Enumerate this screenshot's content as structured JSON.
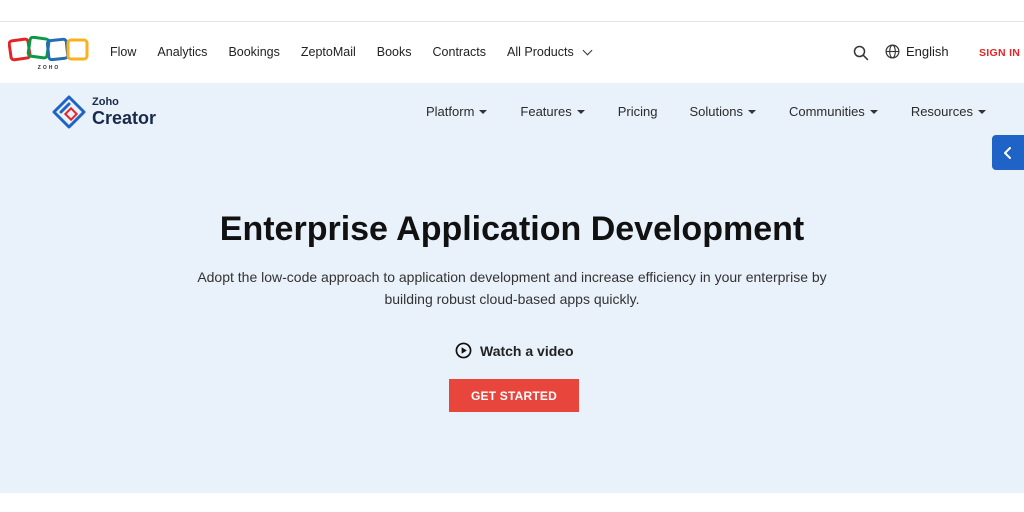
{
  "global_nav": {
    "logo_text": "ZOHO",
    "items": [
      {
        "label": "Flow"
      },
      {
        "label": "Analytics"
      },
      {
        "label": "Bookings"
      },
      {
        "label": "ZeptoMail"
      },
      {
        "label": "Books"
      },
      {
        "label": "Contracts"
      },
      {
        "label": "All Products"
      }
    ],
    "language": "English",
    "sign_in": "SIGN IN"
  },
  "product_header": {
    "brand_top": "Zoho",
    "brand_name": "Creator",
    "menu": [
      {
        "label": "Platform",
        "has_dropdown": true
      },
      {
        "label": "Features",
        "has_dropdown": true
      },
      {
        "label": "Pricing",
        "has_dropdown": false
      },
      {
        "label": "Solutions",
        "has_dropdown": true
      },
      {
        "label": "Communities",
        "has_dropdown": true
      },
      {
        "label": "Resources",
        "has_dropdown": true
      }
    ]
  },
  "hero": {
    "title": "Enterprise Application Development",
    "subtitle": "Adopt the low-code approach to application development and increase efficiency in your enterprise by building robust cloud-based apps quickly.",
    "watch_label": "Watch a video",
    "cta_label": "GET STARTED"
  },
  "colors": {
    "hero_bg": "#e9f1fb",
    "cta": "#e8453c",
    "sign_in": "#e42527",
    "side_tab": "#1e63c5"
  },
  "icons": {
    "search": "search-icon",
    "globe": "globe-icon",
    "play": "play-circle-icon",
    "side_tab": "chevron-left-icon"
  }
}
